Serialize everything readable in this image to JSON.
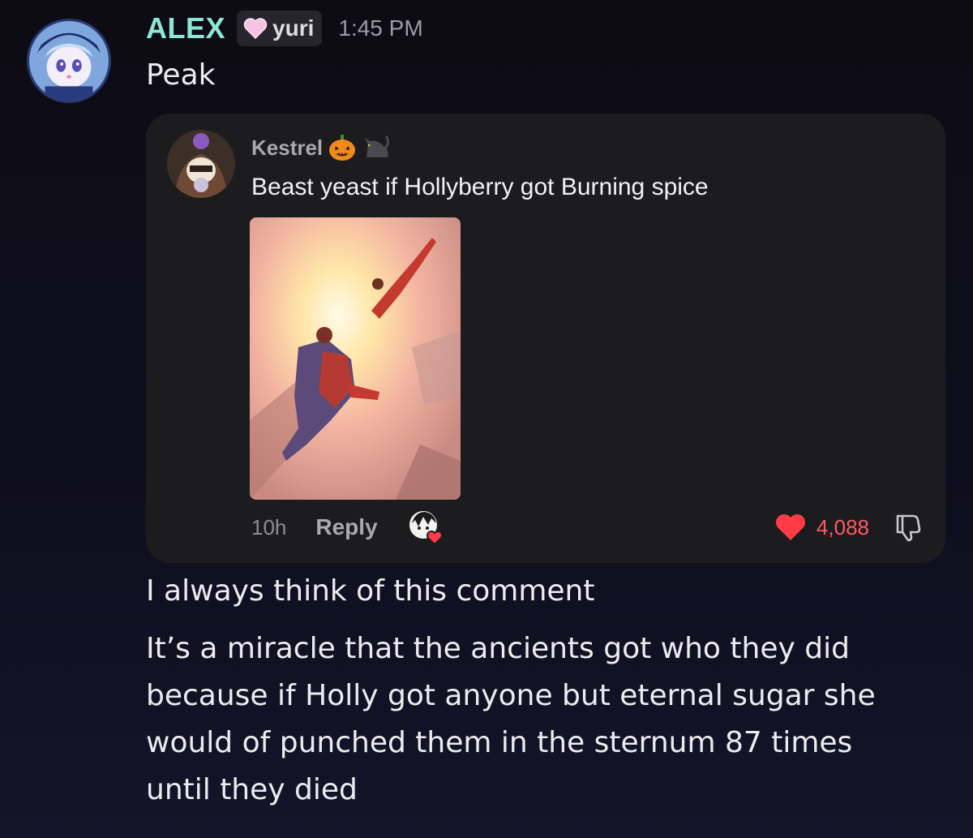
{
  "message": {
    "username": "ALEX",
    "role_tag": "yuri",
    "timestamp": "1:45 PM",
    "first_line": "Peak",
    "lines": [
      "I always think of this comment",
      "It’s a miracle that the ancients got who they did",
      "because if Holly got anyone but eternal sugar she",
      "would of punched them in the sternum  87  times",
      "until they died"
    ]
  },
  "embed": {
    "author_name": "Kestrel",
    "author_emojis": [
      "jack-o-lantern-icon",
      "cat-icon"
    ],
    "text": "Beast yeast if Hollyberry got Burning spice",
    "footer": {
      "time": "10h",
      "reply_label": "Reply",
      "like_count": "4,088"
    }
  },
  "colors": {
    "username": "#8ee6d3",
    "like": "#ff5a63",
    "embed_bg": "#1c1c1e"
  }
}
